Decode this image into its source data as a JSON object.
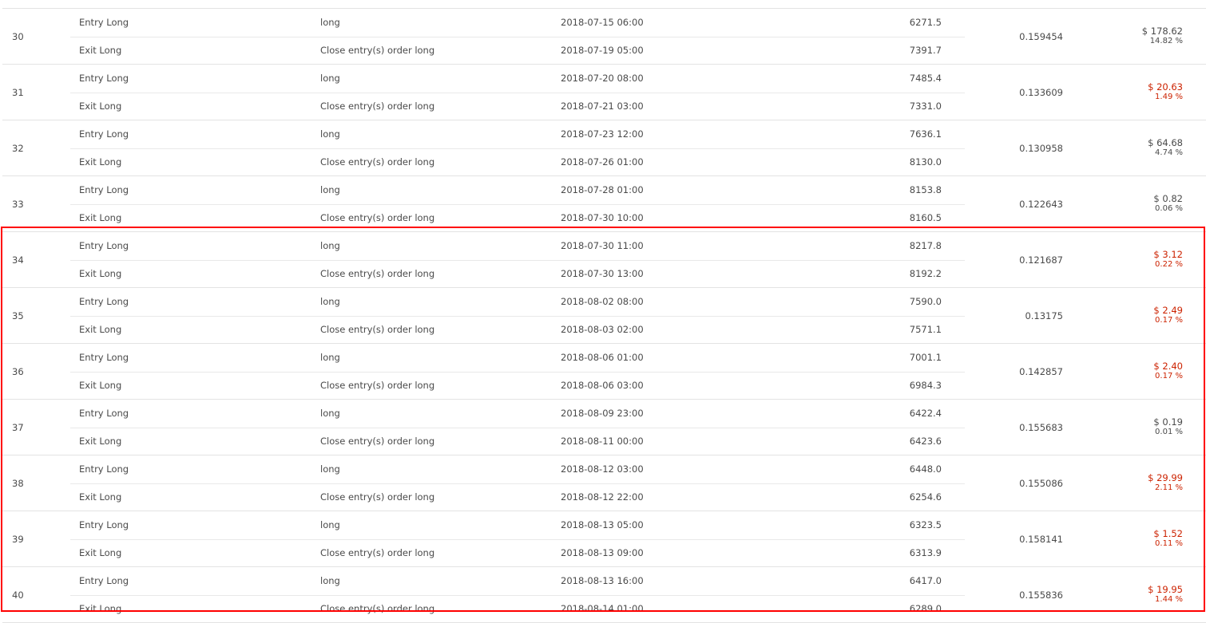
{
  "trades": [
    {
      "num": "30",
      "entry": {
        "type": "Entry Long",
        "signal": "long",
        "date": "2018-07-15 06:00",
        "price": "6271.5"
      },
      "exit": {
        "type": "Exit Long",
        "signal": "Close entry(s) order long",
        "date": "2018-07-19 05:00",
        "price": "7391.7"
      },
      "contracts": "0.159454",
      "profit": "$ 178.62",
      "profit_pct": "14.82 %",
      "loss": false
    },
    {
      "num": "31",
      "entry": {
        "type": "Entry Long",
        "signal": "long",
        "date": "2018-07-20 08:00",
        "price": "7485.4"
      },
      "exit": {
        "type": "Exit Long",
        "signal": "Close entry(s) order long",
        "date": "2018-07-21 03:00",
        "price": "7331.0"
      },
      "contracts": "0.133609",
      "profit": "$ 20.63",
      "profit_pct": "1.49 %",
      "loss": true
    },
    {
      "num": "32",
      "entry": {
        "type": "Entry Long",
        "signal": "long",
        "date": "2018-07-23 12:00",
        "price": "7636.1"
      },
      "exit": {
        "type": "Exit Long",
        "signal": "Close entry(s) order long",
        "date": "2018-07-26 01:00",
        "price": "8130.0"
      },
      "contracts": "0.130958",
      "profit": "$ 64.68",
      "profit_pct": "4.74 %",
      "loss": false
    },
    {
      "num": "33",
      "entry": {
        "type": "Entry Long",
        "signal": "long",
        "date": "2018-07-28 01:00",
        "price": "8153.8"
      },
      "exit": {
        "type": "Exit Long",
        "signal": "Close entry(s) order long",
        "date": "2018-07-30 10:00",
        "price": "8160.5"
      },
      "contracts": "0.122643",
      "profit": "$ 0.82",
      "profit_pct": "0.06 %",
      "loss": false
    },
    {
      "num": "34",
      "entry": {
        "type": "Entry Long",
        "signal": "long",
        "date": "2018-07-30 11:00",
        "price": "8217.8"
      },
      "exit": {
        "type": "Exit Long",
        "signal": "Close entry(s) order long",
        "date": "2018-07-30 13:00",
        "price": "8192.2"
      },
      "contracts": "0.121687",
      "profit": "$ 3.12",
      "profit_pct": "0.22 %",
      "loss": true
    },
    {
      "num": "35",
      "entry": {
        "type": "Entry Long",
        "signal": "long",
        "date": "2018-08-02 08:00",
        "price": "7590.0"
      },
      "exit": {
        "type": "Exit Long",
        "signal": "Close entry(s) order long",
        "date": "2018-08-03 02:00",
        "price": "7571.1"
      },
      "contracts": "0.13175",
      "profit": "$ 2.49",
      "profit_pct": "0.17 %",
      "loss": true
    },
    {
      "num": "36",
      "entry": {
        "type": "Entry Long",
        "signal": "long",
        "date": "2018-08-06 01:00",
        "price": "7001.1"
      },
      "exit": {
        "type": "Exit Long",
        "signal": "Close entry(s) order long",
        "date": "2018-08-06 03:00",
        "price": "6984.3"
      },
      "contracts": "0.142857",
      "profit": "$ 2.40",
      "profit_pct": "0.17 %",
      "loss": true
    },
    {
      "num": "37",
      "entry": {
        "type": "Entry Long",
        "signal": "long",
        "date": "2018-08-09 23:00",
        "price": "6422.4"
      },
      "exit": {
        "type": "Exit Long",
        "signal": "Close entry(s) order long",
        "date": "2018-08-11 00:00",
        "price": "6423.6"
      },
      "contracts": "0.155683",
      "profit": "$ 0.19",
      "profit_pct": "0.01 %",
      "loss": false
    },
    {
      "num": "38",
      "entry": {
        "type": "Entry Long",
        "signal": "long",
        "date": "2018-08-12 03:00",
        "price": "6448.0"
      },
      "exit": {
        "type": "Exit Long",
        "signal": "Close entry(s) order long",
        "date": "2018-08-12 22:00",
        "price": "6254.6"
      },
      "contracts": "0.155086",
      "profit": "$ 29.99",
      "profit_pct": "2.11 %",
      "loss": true
    },
    {
      "num": "39",
      "entry": {
        "type": "Entry Long",
        "signal": "long",
        "date": "2018-08-13 05:00",
        "price": "6323.5"
      },
      "exit": {
        "type": "Exit Long",
        "signal": "Close entry(s) order long",
        "date": "2018-08-13 09:00",
        "price": "6313.9"
      },
      "contracts": "0.158141",
      "profit": "$ 1.52",
      "profit_pct": "0.11 %",
      "loss": true
    },
    {
      "num": "40",
      "entry": {
        "type": "Entry Long",
        "signal": "long",
        "date": "2018-08-13 16:00",
        "price": "6417.0"
      },
      "exit": {
        "type": "Exit Long",
        "signal": "Close entry(s) order long",
        "date": "2018-08-14 01:00",
        "price": "6289.0"
      },
      "contracts": "0.155836",
      "profit": "$ 19.95",
      "profit_pct": "1.44 %",
      "loss": true
    }
  ],
  "colors": {
    "loss": "#cc2200",
    "text": "#4a4a4a",
    "highlight": "#ff0000",
    "border": "#e3e3e3"
  }
}
